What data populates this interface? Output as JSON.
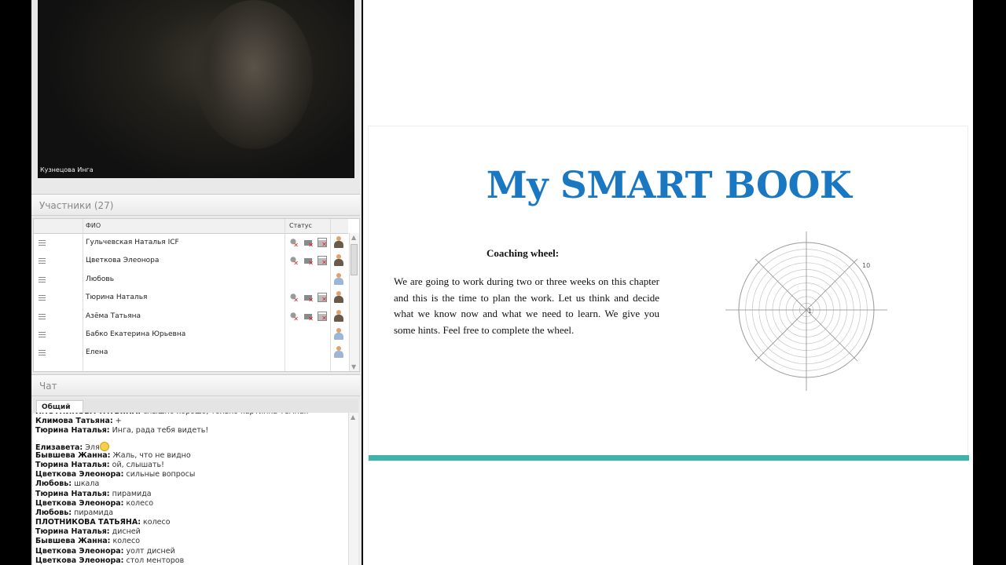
{
  "video": {
    "speaker_label": "Кузнецова Инга"
  },
  "participants": {
    "title": "Участники (27)",
    "col_name": "ФИО",
    "col_status": "Статус",
    "rows": [
      {
        "name": "Гульчевская Наталья ICF",
        "status_icons": true,
        "avatar": "dark"
      },
      {
        "name": "Цветкова Элеонора",
        "status_icons": true,
        "avatar": "dark"
      },
      {
        "name": "Любовь",
        "status_icons": false,
        "avatar": "light"
      },
      {
        "name": "Тюрина Наталья",
        "status_icons": true,
        "avatar": "dark"
      },
      {
        "name": "Азёма Татьяна",
        "status_icons": true,
        "avatar": "dark"
      },
      {
        "name": "Бабко Екатерина  Юрьевна",
        "status_icons": false,
        "avatar": "light"
      },
      {
        "name": "Елена",
        "status_icons": false,
        "avatar": "light"
      }
    ]
  },
  "chat": {
    "title": "Чат",
    "tab_label": "Общий",
    "messages": [
      {
        "author": "ПЛОТНИКОВА ТАТЬЯНА:",
        "text": " слышно хорошо, только картинка темная"
      },
      {
        "author": "Климова Татьяна:",
        "text": " +"
      },
      {
        "author": "Тюрина Наталья:",
        "text": " Инга, рада тебя видеть!"
      },
      {
        "author": "Елизавета:",
        "text": " Эля",
        "smiley": true
      },
      {
        "author": "Бывшева Жанна:",
        "text": " Жаль, что не видно"
      },
      {
        "author": "Тюрина Наталья:",
        "text": " ой, слышать!"
      },
      {
        "author": "Цветкова Элеонора:",
        "text": " сильные вопросы"
      },
      {
        "author": "Любовь:",
        "text": " шкала"
      },
      {
        "author": "Тюрина Наталья:",
        "text": " пирамида"
      },
      {
        "author": "Цветкова Элеонора:",
        "text": " колесо"
      },
      {
        "author": "Любовь:",
        "text": " пирамида"
      },
      {
        "author": "ПЛОТНИКОВА ТАТЬЯНА:",
        "text": " колесо"
      },
      {
        "author": "Тюрина Наталья:",
        "text": " дисней"
      },
      {
        "author": "Бывшева Жанна:",
        "text": " колесо"
      },
      {
        "author": "Цветкова Элеонора:",
        "text": " уолт дисней"
      },
      {
        "author": "Цветкова Элеонора:",
        "text": " стол менторов"
      }
    ]
  },
  "slide": {
    "title": "My SMART BOOK",
    "heading": "Coaching wheel:",
    "body": "We are going to work during two or three weeks on this chapter and this is the time to plan the work. Let us think and decide what we know now and what we need to learn. We give you some hints. Feel free to complete the wheel.",
    "wheel_min_label": "1",
    "wheel_max_label": "10",
    "wheel_rings": 10,
    "wheel_spokes": 8
  },
  "colors": {
    "title_blue": "#1a77c2",
    "teal_bar": "#3fb2aa",
    "mute_red": "#dd2222"
  }
}
